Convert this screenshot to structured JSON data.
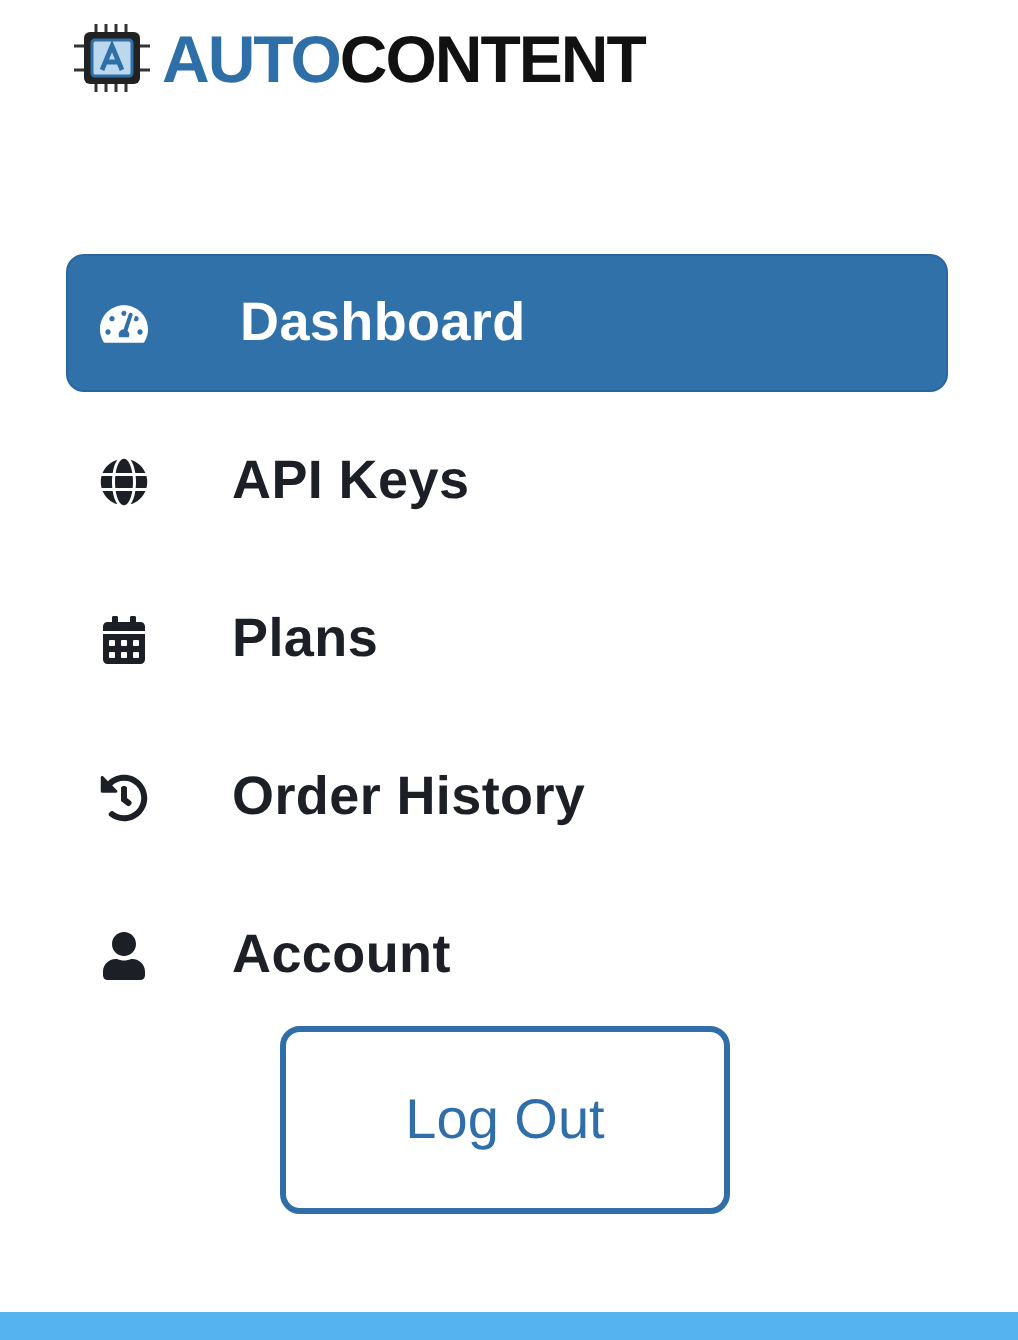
{
  "logo": {
    "primary": "AUTO",
    "secondary": "CONTENT"
  },
  "nav": [
    {
      "label": "Dashboard",
      "selected": true
    },
    {
      "label": "API Keys",
      "selected": false
    },
    {
      "label": "Plans",
      "selected": false
    },
    {
      "label": "Order History",
      "selected": false
    },
    {
      "label": "Account",
      "selected": false
    }
  ],
  "logout": {
    "label": "Log Out"
  }
}
